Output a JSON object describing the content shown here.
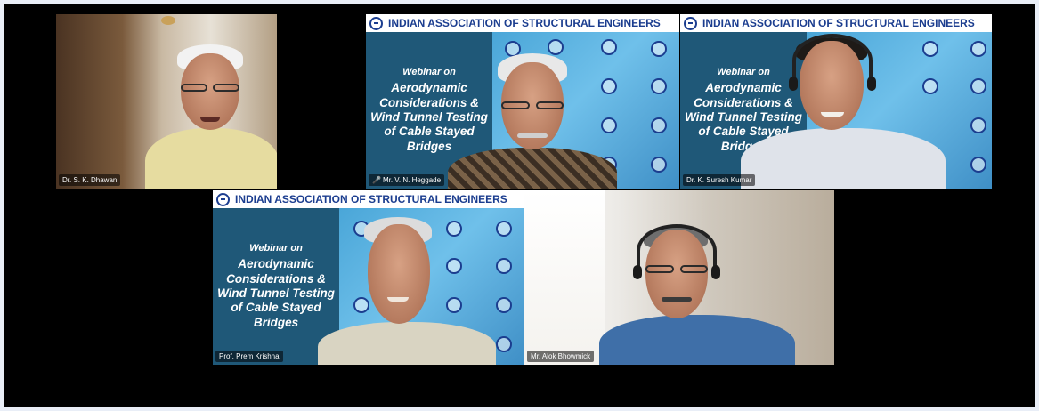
{
  "meeting": {
    "banner_title": "INDIAN ASSOCIATION OF STRUCTURAL ENGINEERS",
    "slide": {
      "line1": "Webinar on",
      "line2": "Aerodynamic",
      "line3": "Considerations &",
      "line4": "Wind Tunnel Testing",
      "line5": "of Cable Stayed",
      "line6": "Bridges"
    }
  },
  "participants": [
    {
      "name": "Dr. S. K. Dhawan",
      "muted": false
    },
    {
      "name": "Mr. V. N. Heggade",
      "muted": true
    },
    {
      "name": "Dr. K. Suresh Kumar",
      "muted": false
    },
    {
      "name": "Prof. Prem Krishna",
      "muted": false
    },
    {
      "name": "Mr. Alok Bhowmick",
      "muted": false
    }
  ],
  "colors": {
    "banner_text": "#1b3d8f",
    "title_panel": "#1f5878",
    "muted_mic": "#e43c3c",
    "backdrop": "#e9eef7"
  }
}
